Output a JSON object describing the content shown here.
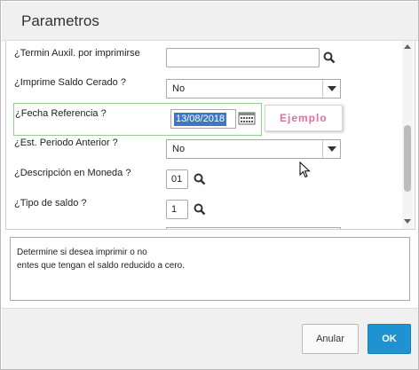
{
  "dialog": {
    "title": "Parametros"
  },
  "fields": {
    "termin_auxil": {
      "label": "¿Termin Auxil. por imprimirse",
      "value": ""
    },
    "imprime_saldo": {
      "label": "¿Imprime Saldo Cerado ?",
      "value": "No"
    },
    "fecha_referencia": {
      "label": "¿Fecha Referencia ?",
      "value": "13/08/2018"
    },
    "est_periodo": {
      "label": "¿Est. Periodo Anterior ?",
      "value": "No"
    },
    "descripcion_moneda": {
      "label": "¿Descripción en Moneda ?",
      "value": "01"
    },
    "tipo_saldo": {
      "label": "¿Tipo de saldo ?",
      "value": "1"
    }
  },
  "tooltip": {
    "text": "Ejemplo"
  },
  "help": {
    "line1": "Determine si desea imprimir o no",
    "line2": "entes que tengan el saldo reducido a cero."
  },
  "buttons": {
    "cancel": "Anular",
    "ok": "OK"
  },
  "colors": {
    "accent": "#1f93d1",
    "highlight_border": "#8fd08f",
    "tooltip_text": "#e06fa3"
  },
  "icons": [
    "search-icon",
    "calendar-icon",
    "chevron-down-icon",
    "mouse-pointer-icon"
  ]
}
